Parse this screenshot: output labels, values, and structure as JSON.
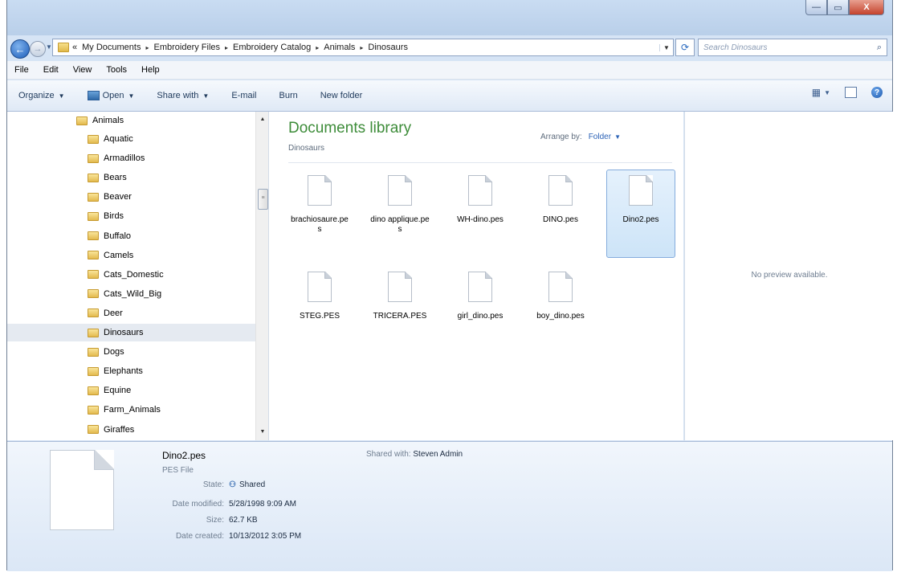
{
  "window": {
    "controls": {
      "minimize": "—",
      "maximize": "▭",
      "close": "X"
    }
  },
  "nav": {
    "back_icon": "back-arrow-icon",
    "forward_icon": "forward-arrow-icon",
    "overflow": "«",
    "breadcrumbs": [
      "My Documents",
      "Embroidery Files",
      "Embroidery Catalog",
      "Animals",
      "Dinosaurs"
    ],
    "separator": "▸",
    "refresh": "⟳",
    "search_placeholder": "Search Dinosaurs",
    "search_icon": "⌕"
  },
  "menubar": [
    "File",
    "Edit",
    "View",
    "Tools",
    "Help"
  ],
  "toolbar": {
    "organize": "Organize",
    "open": "Open",
    "share_with": "Share with",
    "email": "E-mail",
    "burn": "Burn",
    "new_folder": "New folder"
  },
  "tree": {
    "parent": "Animals",
    "children": [
      "Aquatic",
      "Armadillos",
      "Bears",
      "Beaver",
      "Birds",
      "Buffalo",
      "Camels",
      "Cats_Domestic",
      "Cats_Wild_Big",
      "Deer",
      "Dinosaurs",
      "Dogs",
      "Elephants",
      "Equine",
      "Farm_Animals",
      "Giraffes"
    ],
    "selected": "Dinosaurs"
  },
  "library": {
    "title": "Documents library",
    "subtitle": "Dinosaurs",
    "arrange_label": "Arrange by:",
    "arrange_value": "Folder",
    "files": [
      "brachiosaure.pes",
      "dino applique.pes",
      "WH-dino.pes",
      "DINO.pes",
      "Dino2.pes",
      "STEG.PES",
      "TRICERA.PES",
      "girl_dino.pes",
      "boy_dino.pes"
    ],
    "selected": "Dino2.pes"
  },
  "preview": {
    "text": "No preview available."
  },
  "details": {
    "name": "Dino2.pes",
    "type": "PES File",
    "state_label": "State:",
    "state_value": "Shared",
    "modified_label": "Date modified:",
    "modified_value": "5/28/1998 9:09 AM",
    "size_label": "Size:",
    "size_value": "62.7 KB",
    "created_label": "Date created:",
    "created_value": "10/13/2012 3:05 PM",
    "shared_label": "Shared with:",
    "shared_value": "Steven Admin"
  },
  "colors": {
    "library_title": "#3d8c39",
    "link_blue": "#2b62b6",
    "selection": "#cde4f8"
  }
}
